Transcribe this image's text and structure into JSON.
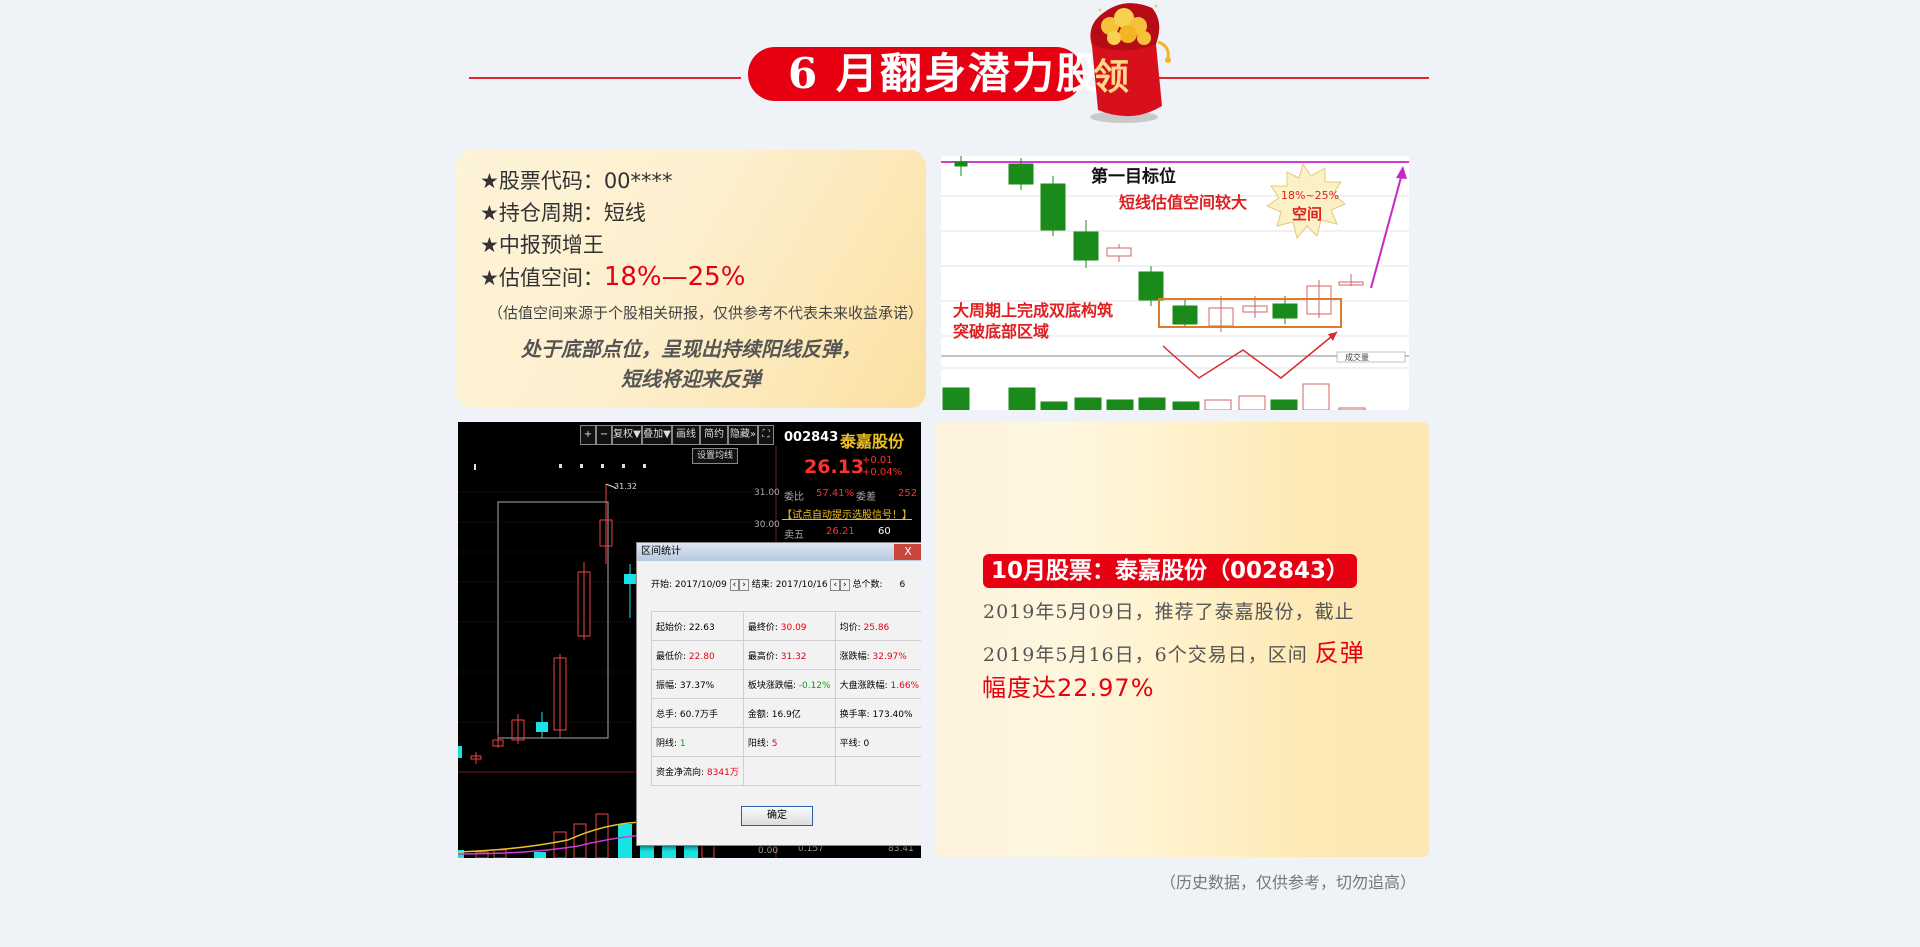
{
  "header": {
    "title": "6 月翻身潜力股",
    "bag_label": "领",
    "colors": {
      "accent": "#e60012",
      "line": "#e2242f"
    }
  },
  "card1": {
    "code": "★股票代码：00****",
    "period": "★持仓周期：短线",
    "tag": "★中报预增王",
    "space_label": "★估值空间：",
    "space_value": "18%—25%",
    "note": "（估值空间来源于个股相关研报，仅供参考不代表未来收益承诺）",
    "quote_line1": "处于底部点位，呈现出持续阳线反弹，",
    "quote_line2": "短线将迎来反弹"
  },
  "chart1": {
    "target": "第一目标位",
    "valuation": "短线估值空间较大",
    "burst_pct": "18%~25%",
    "burst_label": "空间",
    "pattern_line1": "大周期上完成双底构筑",
    "pattern_line2": "突破底部区域",
    "legend_box": "成交量"
  },
  "chart2": {
    "toolbar": [
      "+",
      "−",
      "复权▼",
      "叠加▼",
      "画线",
      "简约",
      "隐藏»",
      "⛶"
    ],
    "settings_btn": "设置均线",
    "stock_code": "002843",
    "stock_name": "泰嘉股份",
    "price": "26.13",
    "change": "+0.01",
    "change_pct": "+0.04%",
    "y_labels": [
      "31.00",
      "30.00"
    ],
    "peak_label": "31.32",
    "ratio_label": "委比",
    "ratio_value": "57.41%",
    "diff_label": "委差",
    "diff_value": "252",
    "alert_link": "【试点自动提示选股信号！】",
    "sell5_label": "卖五",
    "sell5_price": "26.21",
    "sell5_vol": "60",
    "bottom_vals": [
      "0.00",
      "0.157",
      "83.41"
    ],
    "dialog": {
      "title": "区间统计",
      "close": "X",
      "start_label": "开始:",
      "start_value": "2017/10/09",
      "end_label": "结束:",
      "end_value": "2017/10/16",
      "count_label": "总个数:",
      "count_value": "6",
      "rows": [
        [
          [
            "起始价:",
            "22.63"
          ],
          [
            "最终价:",
            "30.09"
          ],
          [
            "均价:",
            "25.86"
          ]
        ],
        [
          [
            "最低价:",
            "22.80"
          ],
          [
            "最高价:",
            "31.32"
          ],
          [
            "涨跌幅:",
            "32.97%"
          ]
        ],
        [
          [
            "振幅:",
            "37.37%"
          ],
          [
            "板块涨跌幅:",
            "-0.12%"
          ],
          [
            "大盘涨跌幅:",
            "1.66%"
          ]
        ],
        [
          [
            "总手:",
            "60.7万手"
          ],
          [
            "金额:",
            "16.9亿"
          ],
          [
            "换手率:",
            "173.40%"
          ]
        ],
        [
          [
            "阴线:",
            "1"
          ],
          [
            "阳线:",
            "5"
          ],
          [
            "平线:",
            "0"
          ]
        ],
        [
          [
            "资金净流向:",
            "8341万"
          ],
          [
            "",
            ""
          ],
          [
            "",
            ""
          ]
        ]
      ],
      "ok": "确定"
    }
  },
  "card2": {
    "badge": "10月股票：泰嘉股份（002843）",
    "line1": "2019年5月09日，推荐了泰嘉股份，截止",
    "line2a": "2019年5月16日，6个交易日，区间",
    "line2b": "反弹",
    "line3": "幅度达22.97%"
  },
  "footnote": "（历史数据，仅供参考，切勿追高）"
}
